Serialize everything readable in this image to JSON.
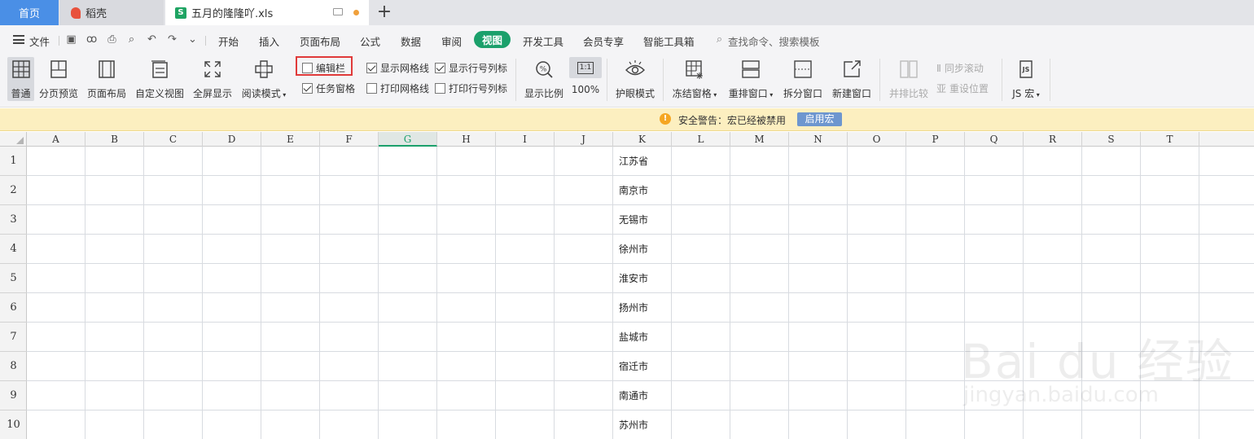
{
  "tabs": {
    "home": "首页",
    "docer": "稻壳",
    "file": "五月的隆隆吖.xls"
  },
  "menubar": {
    "file": "文件",
    "items": [
      "开始",
      "插入",
      "页面布局",
      "公式",
      "数据",
      "审阅",
      "视图",
      "开发工具",
      "会员专享",
      "智能工具箱"
    ],
    "search": "查找命令、搜索模板"
  },
  "ribbon": {
    "normal": "普通",
    "page_break": "分页预览",
    "page_layout": "页面布局",
    "custom_view": "自定义视图",
    "full_screen": "全屏显示",
    "reading_mode": "阅读模式",
    "edit_bar": "编辑栏",
    "task_pane": "任务窗格",
    "show_gridlines": "显示网格线",
    "print_gridlines": "打印网格线",
    "show_headers": "显示行号列标",
    "print_headers": "打印行号列标",
    "zoom": "显示比例",
    "zoom_100": "100%",
    "zoom_100_icon": "1:1",
    "eye_mode": "护眼模式",
    "freeze": "冻结窗格",
    "arrange": "重排窗口",
    "split": "拆分窗口",
    "new_window": "新建窗口",
    "side_by_side": "并排比较",
    "sync_scroll": "同步滚动",
    "reset_position": "重设位置",
    "js_macro": "JS 宏",
    "js_icon": "JS"
  },
  "checkboxes": {
    "edit_bar": false,
    "task_pane": true,
    "show_gridlines": true,
    "print_gridlines": false,
    "show_headers": true,
    "print_headers": false
  },
  "security": {
    "icon": "!",
    "message": "安全警告：宏已经被禁用",
    "button": "启用宏"
  },
  "columns": [
    "A",
    "B",
    "C",
    "D",
    "E",
    "F",
    "G",
    "H",
    "I",
    "J",
    "K",
    "L",
    "M",
    "N",
    "O",
    "P",
    "Q",
    "R",
    "S",
    "T"
  ],
  "selected_column": "G",
  "rows": [
    "1",
    "2",
    "3",
    "4",
    "5",
    "6",
    "7",
    "8",
    "9",
    "10"
  ],
  "column_k": [
    "江苏省",
    "南京市",
    "无锡市",
    "徐州市",
    "淮安市",
    "扬州市",
    "盐城市",
    "宿迁市",
    "南通市",
    "苏州市"
  ],
  "colors": {
    "accent": "#1ba06b",
    "home_tab": "#4a8fe6",
    "highlight": "#e03a3a",
    "warning_bg": "#fcefc0"
  },
  "watermark": {
    "brand": "Bai du 经验",
    "url": "jingyan.baidu.com"
  }
}
